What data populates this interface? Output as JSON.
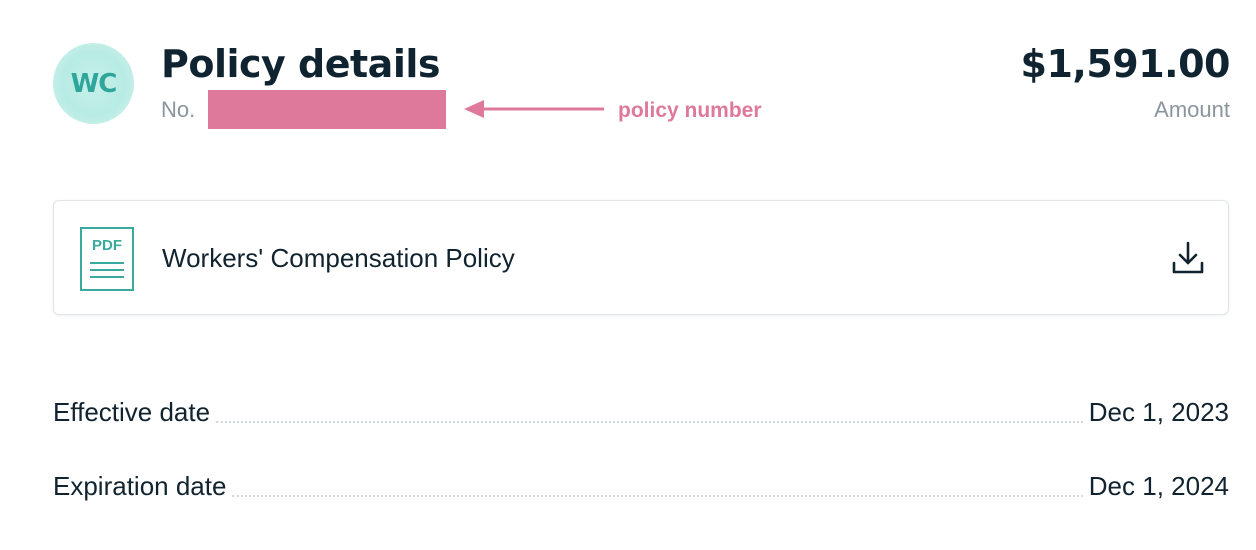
{
  "avatar": {
    "initials": "WC"
  },
  "header": {
    "title": "Policy details",
    "policy_number_prefix": "No. ",
    "amount": "$1,591.00",
    "amount_label": "Amount"
  },
  "annotation": {
    "text": "policy number",
    "color": "#df799b"
  },
  "document": {
    "icon_label": "PDF",
    "name": "Workers' Compensation Policy"
  },
  "details": [
    {
      "label": "Effective date",
      "value": "Dec 1, 2023"
    },
    {
      "label": "Expiration date",
      "value": "Dec 1, 2024"
    }
  ],
  "colors": {
    "text_primary": "#0f2330",
    "text_muted": "#8a959c",
    "accent_teal": "#2fa69b",
    "avatar_bg": "#b7ebe3",
    "annotation_pink": "#df799b"
  }
}
